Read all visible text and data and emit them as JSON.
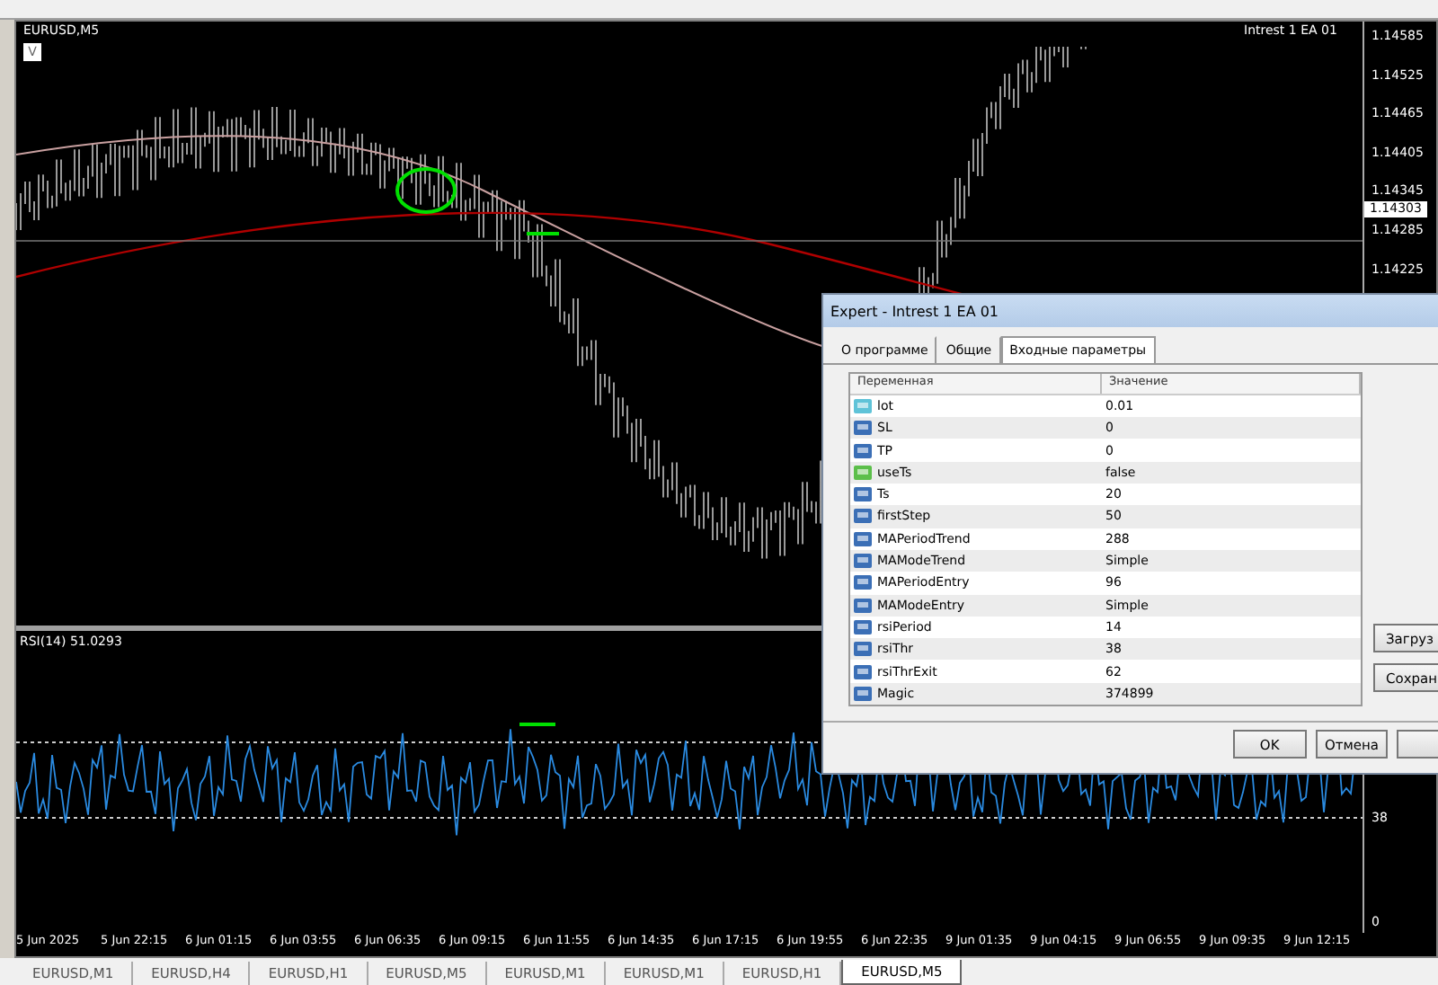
{
  "chart": {
    "symbol": "EURUSD,M5",
    "expert_label": "Intrest 1 EA 01",
    "corner_button": "V",
    "price_axis": [
      "1.14585",
      "1.14525",
      "1.14465",
      "1.14405",
      "1.14345",
      "1.14285",
      "1.14225"
    ],
    "current_price": "1.14303"
  },
  "indicator": {
    "label": "RSI(14) 51.0293",
    "axis": [
      "38",
      "0"
    ]
  },
  "time_axis": [
    "5 Jun 2025",
    "5 Jun 22:15",
    "6 Jun 01:15",
    "6 Jun 03:55",
    "6 Jun 06:35",
    "6 Jun 09:15",
    "6 Jun 11:55",
    "6 Jun 14:35",
    "6 Jun 17:15",
    "6 Jun 19:55",
    "6 Jun 22:35",
    "9 Jun 01:35",
    "9 Jun 04:15",
    "9 Jun 06:55",
    "9 Jun 09:35",
    "9 Jun 12:15"
  ],
  "chart_tabs": [
    {
      "label": "EURUSD,M1",
      "selected": false
    },
    {
      "label": "EURUSD,H4",
      "selected": false
    },
    {
      "label": "EURUSD,H1",
      "selected": false
    },
    {
      "label": "EURUSD,M5",
      "selected": false
    },
    {
      "label": "EURUSD,M1",
      "selected": false
    },
    {
      "label": "EURUSD,M1",
      "selected": false
    },
    {
      "label": "EURUSD,H1",
      "selected": false
    },
    {
      "label": "EURUSD,M5",
      "selected": true
    }
  ],
  "dialog": {
    "title": "Expert - Intrest 1 EA 01",
    "tabs": [
      {
        "label": "О программе",
        "selected": false
      },
      {
        "label": "Общие",
        "selected": false
      },
      {
        "label": "Входные параметры",
        "selected": true
      }
    ],
    "columns": [
      "Переменная",
      "Значение"
    ],
    "rows": [
      {
        "kind": "double",
        "name": "lot",
        "value": "0.01"
      },
      {
        "kind": "int",
        "name": "SL",
        "value": "0"
      },
      {
        "kind": "int",
        "name": "TP",
        "value": "0"
      },
      {
        "kind": "bool",
        "name": "useTs",
        "value": "false"
      },
      {
        "kind": "int",
        "name": "Ts",
        "value": "20"
      },
      {
        "kind": "int",
        "name": "firstStep",
        "value": "50"
      },
      {
        "kind": "int",
        "name": "MAPeriodTrend",
        "value": "288"
      },
      {
        "kind": "int",
        "name": "MAModeTrend",
        "value": "Simple"
      },
      {
        "kind": "int",
        "name": "MAPeriodEntry",
        "value": "96"
      },
      {
        "kind": "int",
        "name": "MAModeEntry",
        "value": "Simple"
      },
      {
        "kind": "int",
        "name": "rsiPeriod",
        "value": "14"
      },
      {
        "kind": "int",
        "name": "rsiThr",
        "value": "38"
      },
      {
        "kind": "int",
        "name": "rsiThrExit",
        "value": "62"
      },
      {
        "kind": "int",
        "name": "Magic",
        "value": "374899"
      }
    ],
    "side_buttons": [
      "Загруз",
      "Сохран"
    ],
    "buttons": [
      "OK",
      "Отмена"
    ]
  }
}
